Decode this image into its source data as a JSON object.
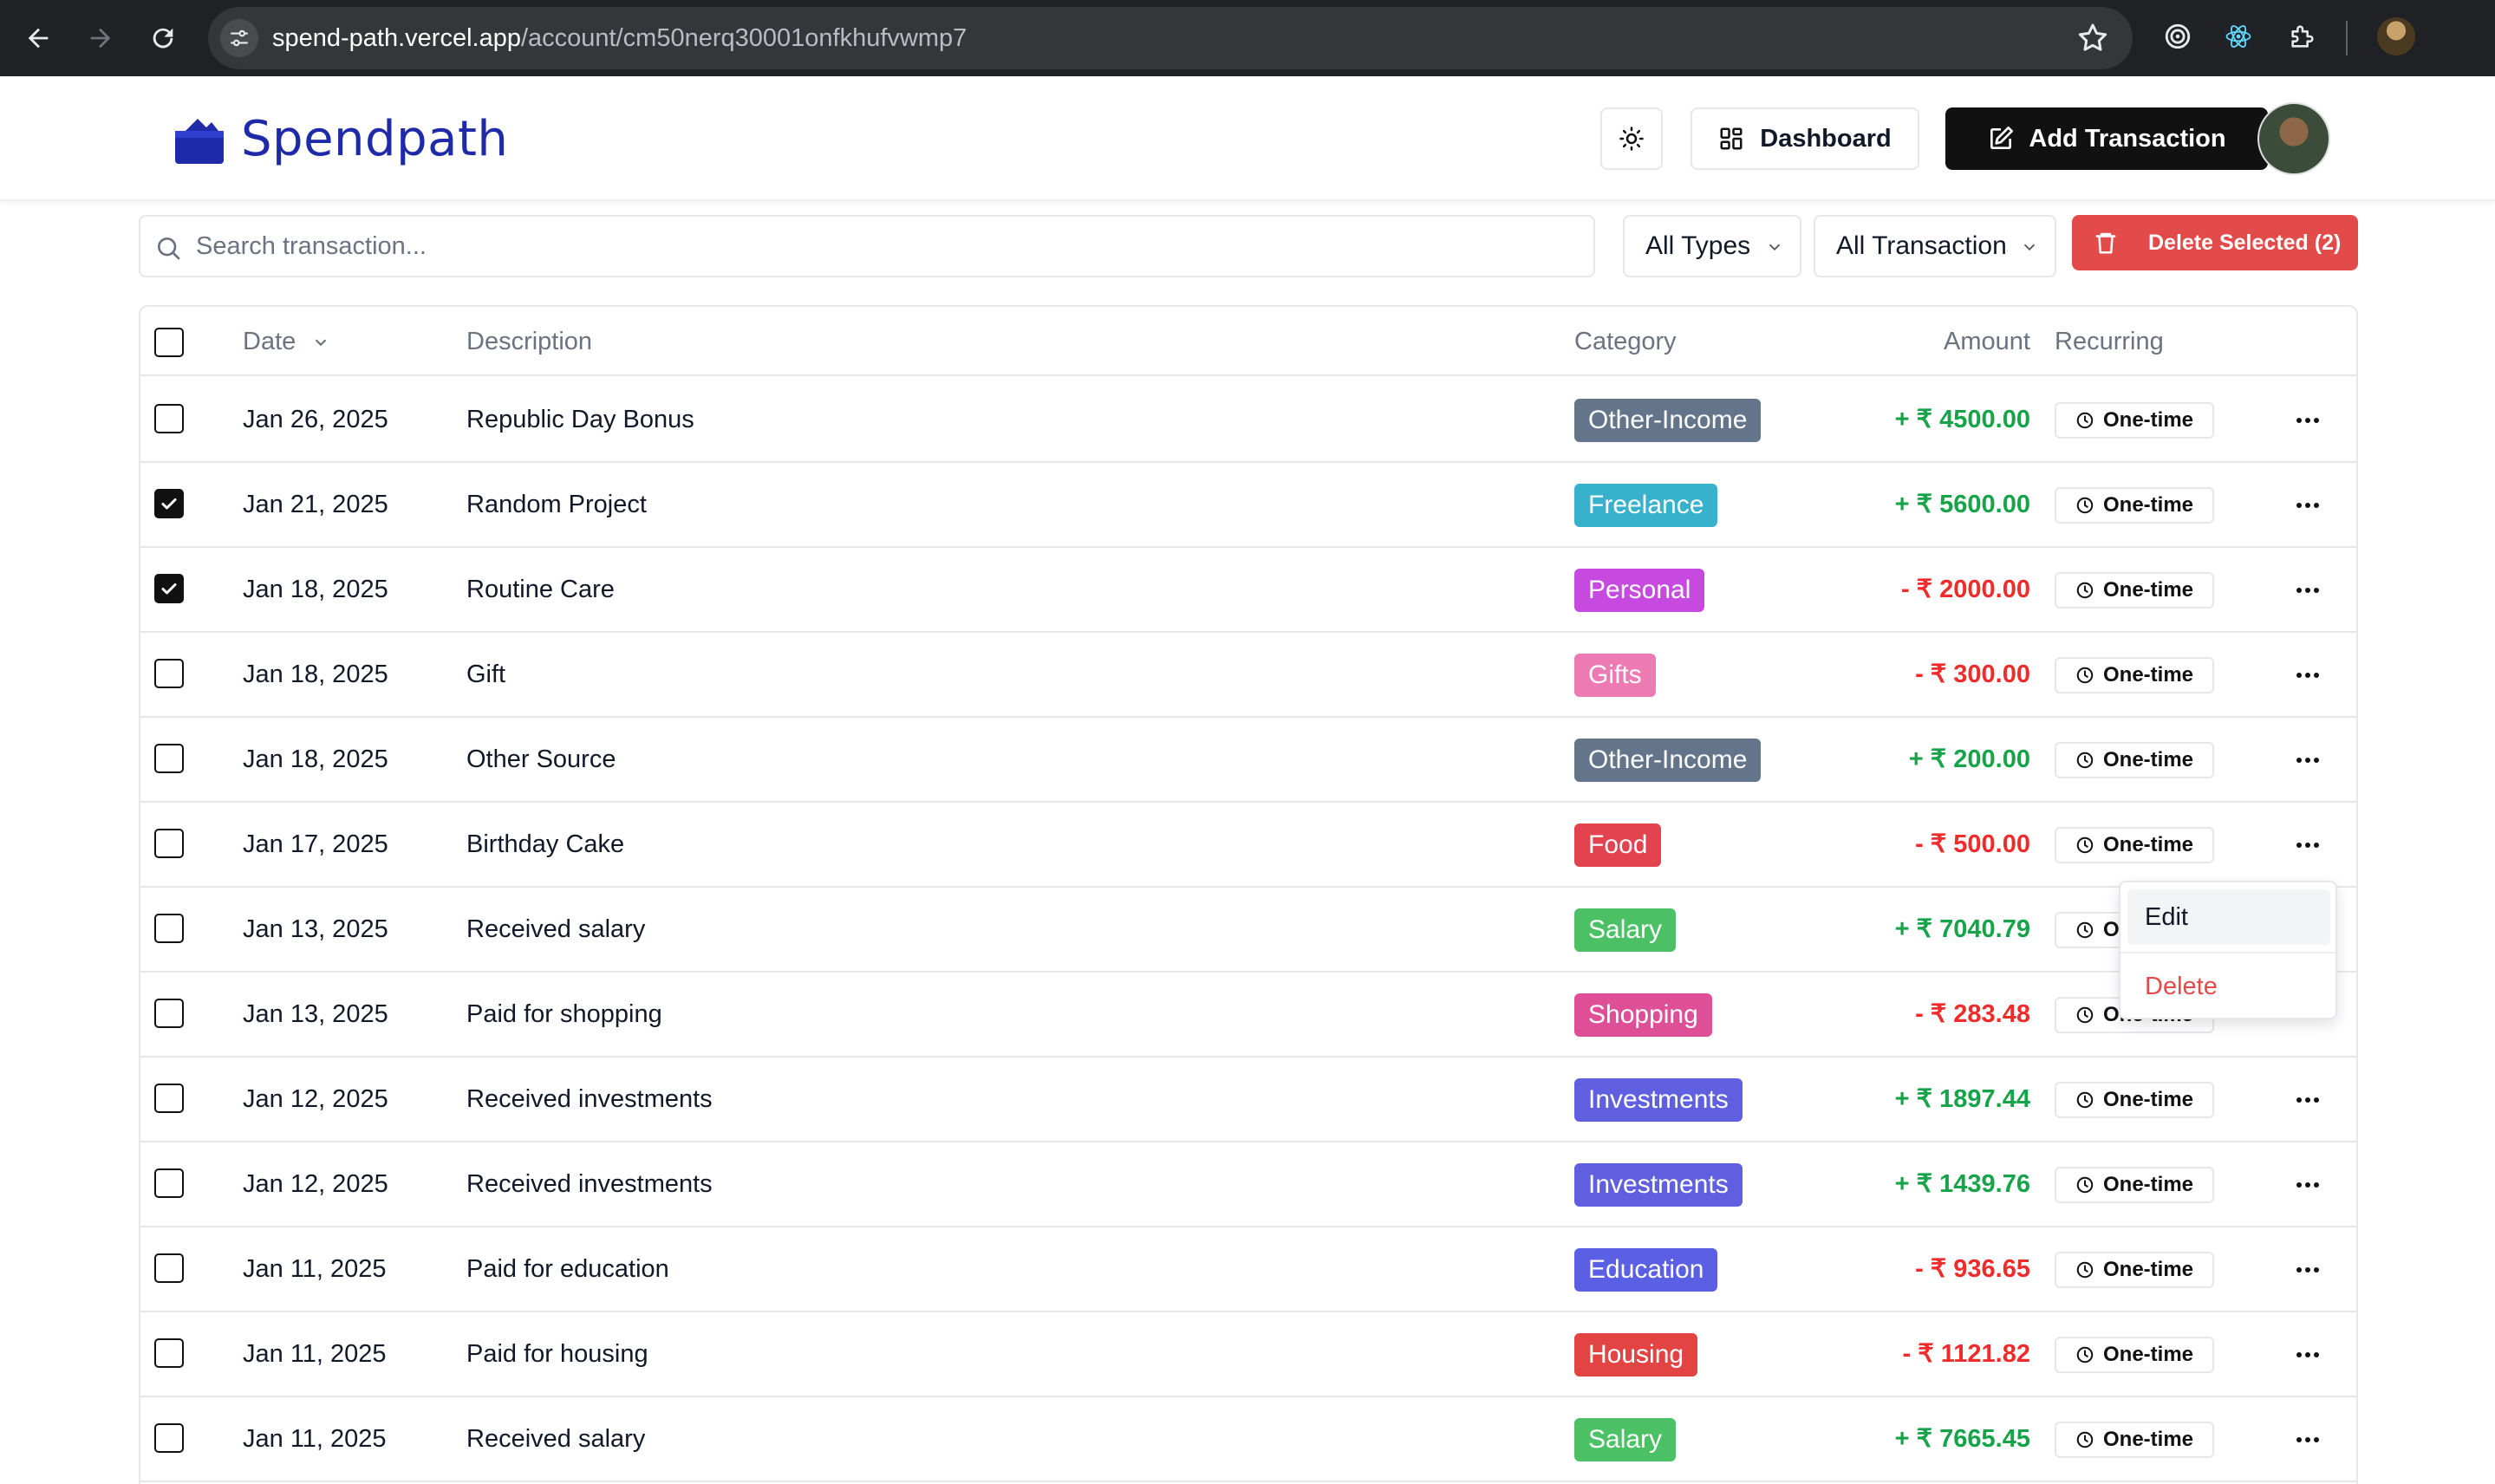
{
  "browser": {
    "url_host": "spend-path.vercel.app",
    "url_path": "/account/cm50nerq30001onfkhufvwmp7",
    "icons": [
      "back-icon",
      "forward-icon",
      "reload-icon",
      "site-settings-icon",
      "bookmark-star-icon",
      "extension-target-icon",
      "react-devtools-icon",
      "extensions-puzzle-icon",
      "profile-avatar"
    ]
  },
  "app": {
    "brand": "Spendpath",
    "header": {
      "dashboard_label": "Dashboard",
      "add_transaction_label": "Add Transaction"
    }
  },
  "toolbar": {
    "search_placeholder": "Search transaction...",
    "type_filter": "All Types",
    "transaction_filter": "All Transactions",
    "delete_selected_label": "Delete Selected (2)"
  },
  "table": {
    "headers": {
      "date": "Date",
      "description": "Description",
      "category": "Category",
      "amount": "Amount",
      "recurring": "Recurring"
    },
    "rows": [
      {
        "date": "Jan 26, 2025",
        "description": "Republic Day Bonus",
        "category": "Other-Income",
        "category_color": "#64748b",
        "amount": "+ ₹ 4500.00",
        "amount_color": "#16a34a",
        "recurring": "One-time",
        "checked": false
      },
      {
        "date": "Jan 21, 2025",
        "description": "Random Project",
        "category": "Freelance",
        "category_color": "#38b2cc",
        "amount": "+ ₹ 5600.00",
        "amount_color": "#16a34a",
        "recurring": "One-time",
        "checked": true
      },
      {
        "date": "Jan 18, 2025",
        "description": "Routine Care",
        "category": "Personal",
        "category_color": "#c64ae0",
        "amount": "- ₹ 2000.00",
        "amount_color": "#ef2b2b",
        "recurring": "One-time",
        "checked": true
      },
      {
        "date": "Jan 18, 2025",
        "description": "Gift",
        "category": "Gifts",
        "category_color": "#ec7ab3",
        "amount": "- ₹ 300.00",
        "amount_color": "#ef2b2b",
        "recurring": "One-time",
        "checked": false
      },
      {
        "date": "Jan 18, 2025",
        "description": "Other Source",
        "category": "Other-Income",
        "category_color": "#64748b",
        "amount": "+ ₹ 200.00",
        "amount_color": "#16a34a",
        "recurring": "One-time",
        "checked": false
      },
      {
        "date": "Jan 17, 2025",
        "description": "Birthday Cake",
        "category": "Food",
        "category_color": "#e2434f",
        "amount": "- ₹ 500.00",
        "amount_color": "#ef2b2b",
        "recurring": "One-time",
        "checked": false
      },
      {
        "date": "Jan 13, 2025",
        "description": "Received salary",
        "category": "Salary",
        "category_color": "#4cc065",
        "amount": "+ ₹ 7040.79",
        "amount_color": "#16a34a",
        "recurring": "One-time",
        "checked": false
      },
      {
        "date": "Jan 13, 2025",
        "description": "Paid for shopping",
        "category": "Shopping",
        "category_color": "#df4f98",
        "amount": "- ₹ 283.48",
        "amount_color": "#ef2b2b",
        "recurring": "One-time",
        "checked": false
      },
      {
        "date": "Jan 12, 2025",
        "description": "Received investments",
        "category": "Investments",
        "category_color": "#5f5fe0",
        "amount": "+ ₹ 1897.44",
        "amount_color": "#16a34a",
        "recurring": "One-time",
        "checked": false
      },
      {
        "date": "Jan 12, 2025",
        "description": "Received investments",
        "category": "Investments",
        "category_color": "#5f5fe0",
        "amount": "+ ₹ 1439.76",
        "amount_color": "#16a34a",
        "recurring": "One-time",
        "checked": false
      },
      {
        "date": "Jan 11, 2025",
        "description": "Paid for education",
        "category": "Education",
        "category_color": "#5b5fe4",
        "amount": "- ₹ 936.65",
        "amount_color": "#ef2b2b",
        "recurring": "One-time",
        "checked": false
      },
      {
        "date": "Jan 11, 2025",
        "description": "Paid for housing",
        "category": "Housing",
        "category_color": "#e24343",
        "amount": "- ₹ 1121.82",
        "amount_color": "#ef2b2b",
        "recurring": "One-time",
        "checked": false
      },
      {
        "date": "Jan 11, 2025",
        "description": "Received salary",
        "category": "Salary",
        "category_color": "#4cc065",
        "amount": "+ ₹ 7665.45",
        "amount_color": "#16a34a",
        "recurring": "One-time",
        "checked": false
      }
    ]
  },
  "row_menu": {
    "edit_label": "Edit",
    "delete_label": "Delete"
  }
}
